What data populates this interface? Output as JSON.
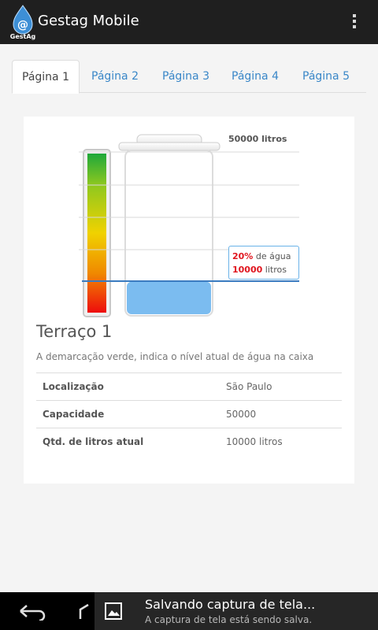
{
  "app": {
    "title": "Gestag Mobile",
    "icon": "gestag-logo-icon",
    "logo_text": "GestAg"
  },
  "tabs": [
    {
      "label": "Página 1",
      "active": true
    },
    {
      "label": "Página 2",
      "active": false
    },
    {
      "label": "Página 3",
      "active": false
    },
    {
      "label": "Página 4",
      "active": false
    },
    {
      "label": "Página 5",
      "active": false
    }
  ],
  "gauge": {
    "capacity_label": "50000 litros",
    "level_percent": 20,
    "tooltip_percent": "20%",
    "tooltip_percent_suffix": " de água",
    "tooltip_liters": "10000",
    "tooltip_liters_suffix": " litros",
    "water_color": "#7bbcf0",
    "marker_color": "#3a7bc0"
  },
  "tank": {
    "title": "Terraço 1",
    "description": "A demarcação verde, indica o nível atual de água na caixa",
    "rows": [
      {
        "label": "Localização",
        "value": "São Paulo"
      },
      {
        "label": "Capacidade",
        "value": "50000"
      },
      {
        "label": "Qtd. de litros atual",
        "value": "10000 litros"
      }
    ]
  },
  "notification": {
    "title": "Salvando captura de tela...",
    "subtitle": "A captura de tela está sendo salva.",
    "icon": "image-icon"
  },
  "navbar": {
    "back_icon": "back-icon",
    "home_icon": "home-icon"
  }
}
